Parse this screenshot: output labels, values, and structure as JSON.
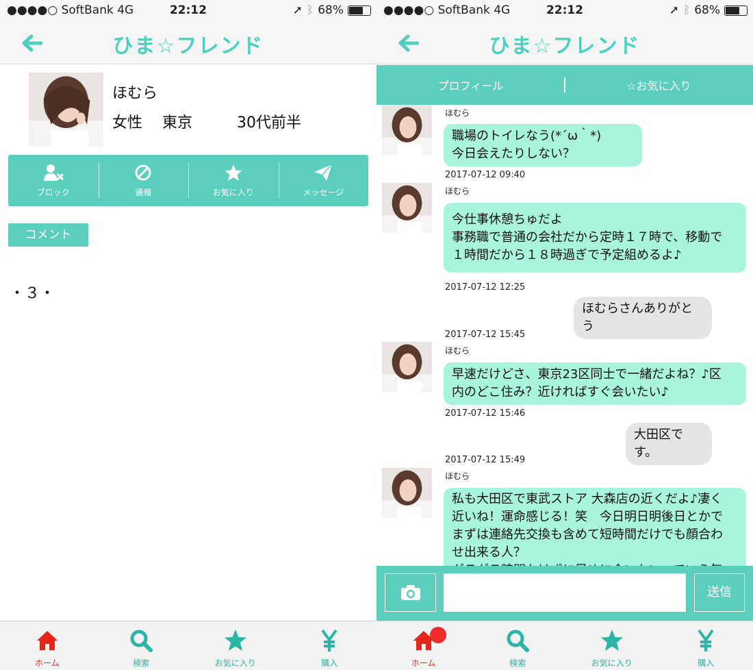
{
  "status_bar": {
    "carrier": "●●●●○ SoftBank  4G",
    "time": "22:12",
    "battery": "68%",
    "battery_level": 0.68
  },
  "header": {
    "logo": "ひま☆フレンド"
  },
  "profile": {
    "name": "ほむら",
    "gender": "女性",
    "location": "東京",
    "age": "30代前半",
    "actions": [
      "ブロック",
      "通報",
      "お気に入り",
      "メッセージ"
    ],
    "comment_label": "コメント",
    "comment_text": "・３・"
  },
  "chat": {
    "subtabs": [
      "プロフィール",
      "☆お気に入り"
    ],
    "messages": [
      {
        "from": "ほむら",
        "text": "職場のトイレなう(*´ω｀*)\n今日会えたりしない？",
        "time": "2017-07-12 09:40"
      },
      {
        "from": "ほむら",
        "text": "今仕事休憩ちゅだよ\n事務職で普通の会社だから定時１７時で、移動で\n１時間だから１８時過ぎで予定組めるよ♪",
        "time": "2017-07-12 12:25"
      },
      {
        "text": "ほむらさんありがとう",
        "time": "2017-07-12 15:45"
      },
      {
        "from": "ほむら",
        "text": "早速だけどさ、東京23区同士で一緒だよね？♪区\n内のどこ住み？近ければすぐ会いたい♪",
        "time": "2017-07-12 15:46"
      },
      {
        "text": "大田区です。",
        "time": "2017-07-12 15:49"
      },
      {
        "from": "ほむら",
        "text": "私も大田区で東武ストア 大森店の近くだよ♪凄く\n近いね！運命感じる！笑　今日明日明後日とかで\nまずは連絡先交換も含めて短時間だけでも顔合わ\nせ出来る人？\nダラダラ時間かけずに早めに会いたいっていう気"
      }
    ],
    "send_label": "送信"
  },
  "tabbar": {
    "items": [
      {
        "label": "ホーム",
        "icon": "home-icon"
      },
      {
        "label": "検索",
        "icon": "search-icon"
      },
      {
        "label": "お気に入り",
        "icon": "star-icon"
      },
      {
        "label": "購入",
        "icon": "yen-icon"
      }
    ]
  },
  "colors": {
    "accent": "#5bcfbc",
    "incoming_bubble": "#a8f4dc",
    "outgoing_bubble": "#e4e4e4",
    "active_tab": "#e5271b",
    "tab_icon": "#2ab5a5"
  }
}
